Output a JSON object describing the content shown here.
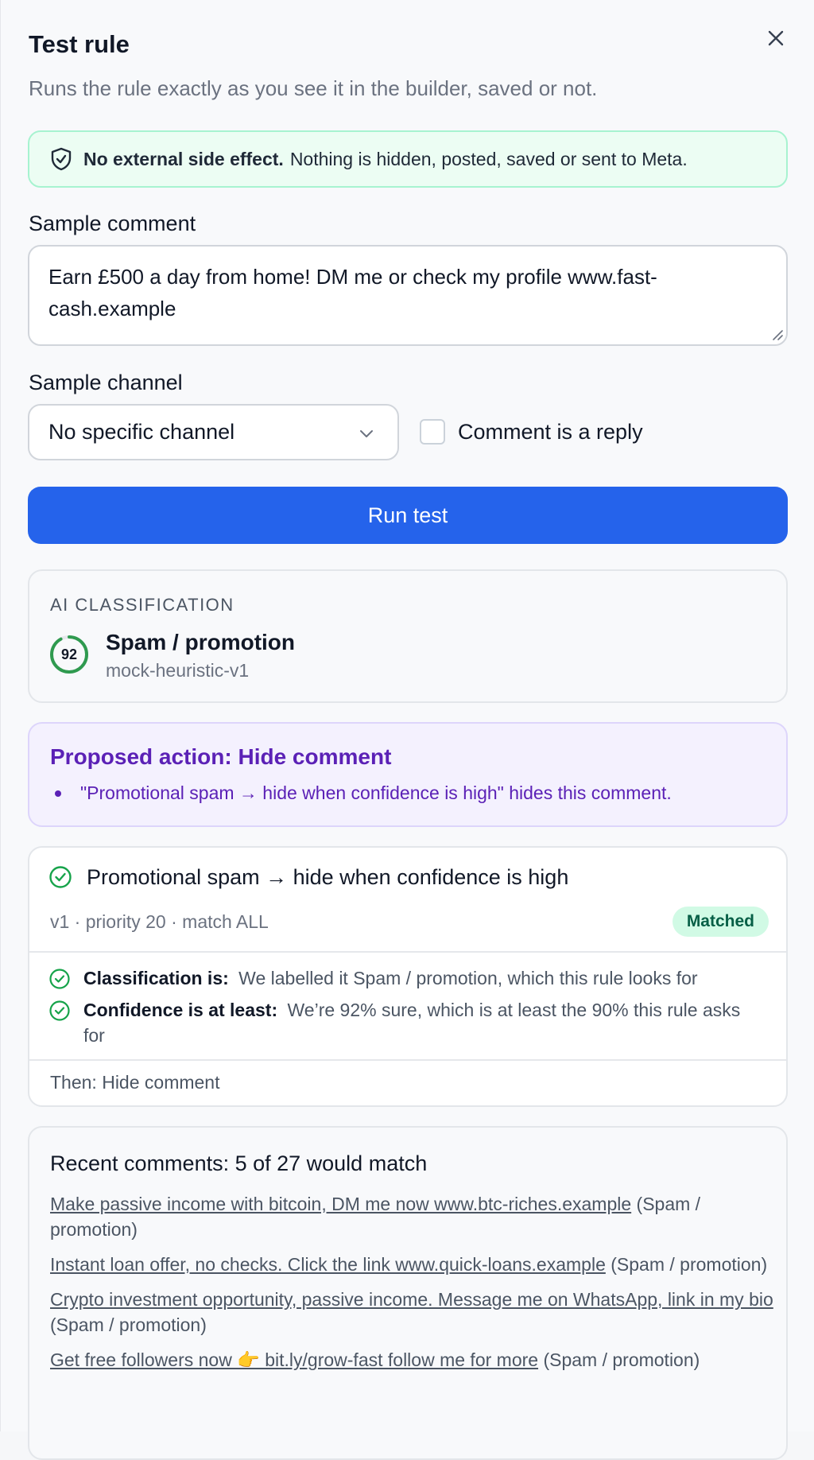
{
  "header": {
    "title": "Test rule",
    "subtitle": "Runs the rule exactly as you see it in the builder, saved or not."
  },
  "notice": {
    "bold": "No external side effect.",
    "text": "Nothing is hidden, posted, saved or sent to Meta."
  },
  "sample_comment": {
    "label": "Sample comment",
    "value": "Earn £500 a day from home! DM me or check my profile www.fast-cash.example"
  },
  "sample_channel": {
    "label": "Sample channel",
    "selected": "No specific channel",
    "reply_label": "Comment is a reply"
  },
  "run_button": "Run test",
  "ai": {
    "heading": "AI CLASSIFICATION",
    "confidence": 92,
    "confidence_fraction": 0.92,
    "label": "Spam / promotion",
    "model": "mock-heuristic-v1",
    "color": "#2f9a4f"
  },
  "proposed": {
    "title": "Proposed action: Hide comment",
    "item": "\"Promotional spam → hide when confidence is high\" hides this comment."
  },
  "rule": {
    "name": "Promotional spam → hide when confidence is high",
    "meta": "v1 · priority 20 · match ALL",
    "badge": "Matched",
    "conditions": [
      {
        "label": "Classification is:",
        "text": "We labelled it Spam / promotion, which this rule looks for"
      },
      {
        "label": "Confidence is at least:",
        "text": "We’re 92% sure, which is at least the 90% this rule asks for"
      }
    ],
    "then": "Then: Hide comment"
  },
  "recent": {
    "title": "Recent comments: 5 of 27 would match",
    "items": [
      {
        "link": "Make passive income with bitcoin, DM me now www.btc-riches.example",
        "tag": "(Spam / promotion)"
      },
      {
        "link": "Instant loan offer, no checks. Click the link www.quick-loans.example",
        "tag": "(Spam / promotion)"
      },
      {
        "link": "Crypto investment opportunity, passive income. Message me on WhatsApp, link in my bio",
        "tag": "(Spam / promotion)"
      },
      {
        "link": "Get free followers now 👉 bit.ly/grow-fast follow me for more",
        "tag": "(Spam / promotion)"
      }
    ]
  }
}
